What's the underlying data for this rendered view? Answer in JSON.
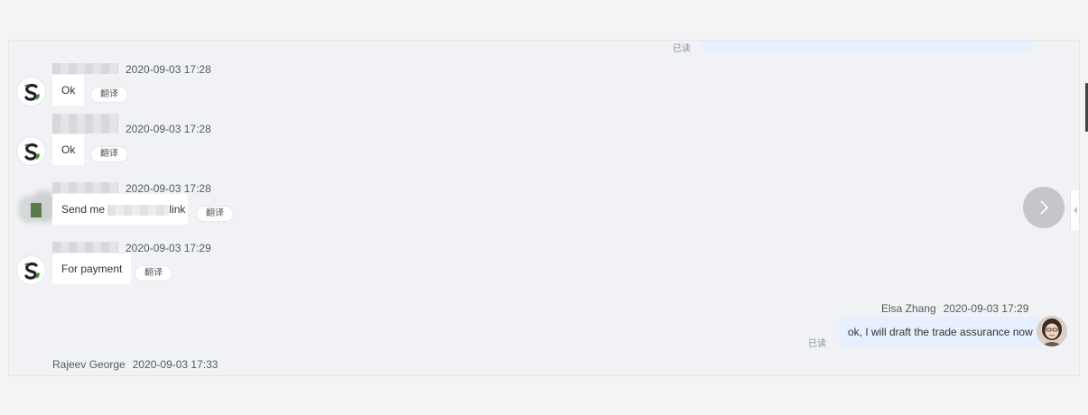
{
  "read_label": "已读",
  "translate_label": "翻译",
  "messages": [
    {
      "time": "2020-09-03 17:28",
      "text": "Ok"
    },
    {
      "time": "2020-09-03 17:28",
      "text": "Ok"
    },
    {
      "time": "2020-09-03 17:28",
      "text_before": "Send me",
      "text_after": "link"
    },
    {
      "time": "2020-09-03 17:29",
      "text": "For payment"
    }
  ],
  "outgoing": {
    "sender": "Elsa Zhang",
    "time": "2020-09-03 17:29",
    "text": "ok, I will draft the trade assurance now"
  },
  "last_message": {
    "sender": "Rajeev George",
    "time": "2020-09-03 17:33"
  },
  "icons": {
    "next": "chevron-right-icon",
    "collapse": "caret-left-icon"
  },
  "colors": {
    "outgoing_bubble": "#e6f0fe",
    "panel_bg": "#f0f2f5",
    "logo_green": "#3a8d2f"
  }
}
